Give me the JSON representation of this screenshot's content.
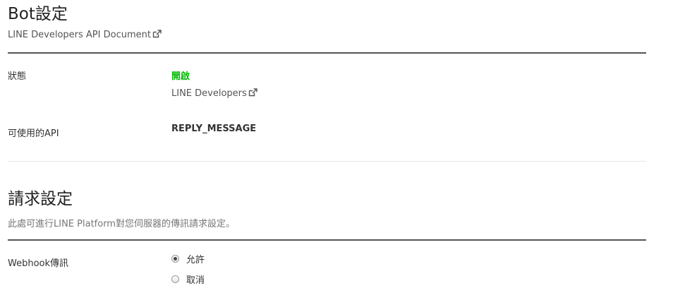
{
  "bot_settings": {
    "title": "Bot設定",
    "doc_link": "LINE Developers API Document",
    "status": {
      "label": "狀態",
      "value": "開啟",
      "value_color": "#00b900",
      "link": "LINE Developers"
    },
    "api": {
      "label": "可使用的API",
      "value": "REPLY_MESSAGE"
    }
  },
  "request_settings": {
    "title": "請求設定",
    "description": "此處可進行LINE Platform對您伺服器的傳訊請求設定。",
    "webhook": {
      "label": "Webhook傳訊",
      "options": [
        {
          "label": "允許",
          "checked": true
        },
        {
          "label": "取消",
          "checked": false
        }
      ]
    }
  },
  "icons": {
    "external_link": "external-link-icon",
    "radio_checked": "radio-checked-icon",
    "radio_unchecked": "radio-unchecked-icon"
  }
}
